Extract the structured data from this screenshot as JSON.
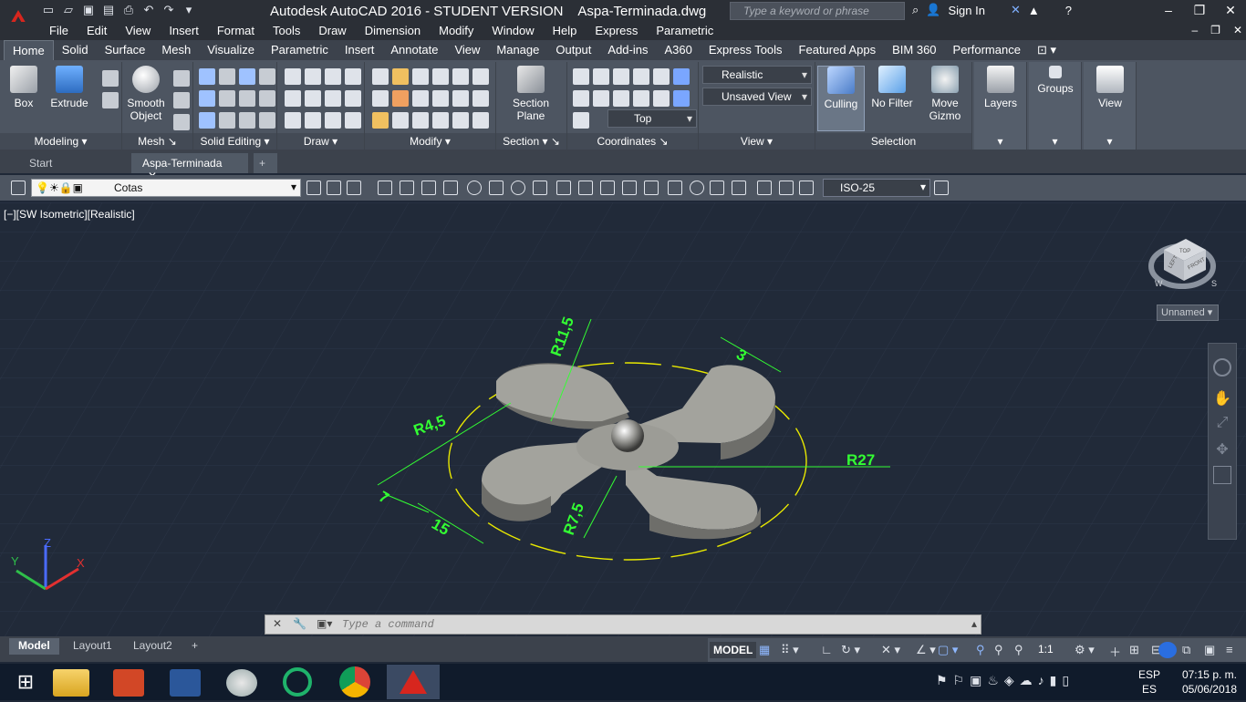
{
  "title": {
    "app": "Autodesk AutoCAD 2016 - STUDENT VERSION",
    "doc": "Aspa-Terminada.dwg",
    "search_placeholder": "Type a keyword or phrase",
    "signin": "Sign In"
  },
  "menus": [
    "File",
    "Edit",
    "View",
    "Insert",
    "Format",
    "Tools",
    "Draw",
    "Dimension",
    "Modify",
    "Window",
    "Help",
    "Express",
    "Parametric"
  ],
  "ribbon_tabs": [
    "Home",
    "Solid",
    "Surface",
    "Mesh",
    "Visualize",
    "Parametric",
    "Insert",
    "Annotate",
    "View",
    "Manage",
    "Output",
    "Add-ins",
    "A360",
    "Express Tools",
    "Featured Apps",
    "BIM 360",
    "Performance"
  ],
  "ribbon": {
    "modeling": {
      "title": "Modeling",
      "box": "Box",
      "extrude": "Extrude"
    },
    "mesh": {
      "title": "Mesh",
      "smooth1": "Smooth",
      "smooth2": "Object"
    },
    "solid_editing": {
      "title": "Solid Editing"
    },
    "draw": {
      "title": "Draw"
    },
    "modify": {
      "title": "Modify"
    },
    "section": {
      "title": "Section",
      "plane1": "Section",
      "plane2": "Plane"
    },
    "coordinates": {
      "title": "Coordinates"
    },
    "view": {
      "title": "View",
      "visual_style": "Realistic",
      "named_view": "Unsaved View",
      "view_dir": "Top"
    },
    "selection": {
      "title": "Selection",
      "culling": "Culling",
      "filter": "No Filter",
      "gizmo1": "Move",
      "gizmo2": "Gizmo"
    },
    "layers": "Layers",
    "groups": "Groups",
    "view_panel": "View"
  },
  "file_tabs": [
    "Start",
    "Aspa-Terminada"
  ],
  "layer_current": "Cotas",
  "dim_style": "ISO-25",
  "viewport_label": "[−][SW Isometric][Realistic]",
  "viewcube": {
    "top": "TOP",
    "left": "LEFT",
    "front": "FRONT",
    "w": "W",
    "s": "S",
    "ucs_name": "Unnamed"
  },
  "dimensions": [
    "R11,5",
    "R4,5",
    "R27",
    "R7,5",
    "15",
    "7",
    "3"
  ],
  "command_placeholder": "Type a command",
  "layout_tabs": [
    "Model",
    "Layout1",
    "Layout2"
  ],
  "status": {
    "model": "MODEL",
    "scale": "1:1"
  },
  "tray": {
    "lang1": "ESP",
    "lang2": "ES",
    "time": "07:15 p. m.",
    "date": "05/06/2018"
  },
  "colors": {
    "dim": "#33ff33",
    "circle": "#e8e800",
    "model": "#a3a39d",
    "bg": "#212a39"
  }
}
